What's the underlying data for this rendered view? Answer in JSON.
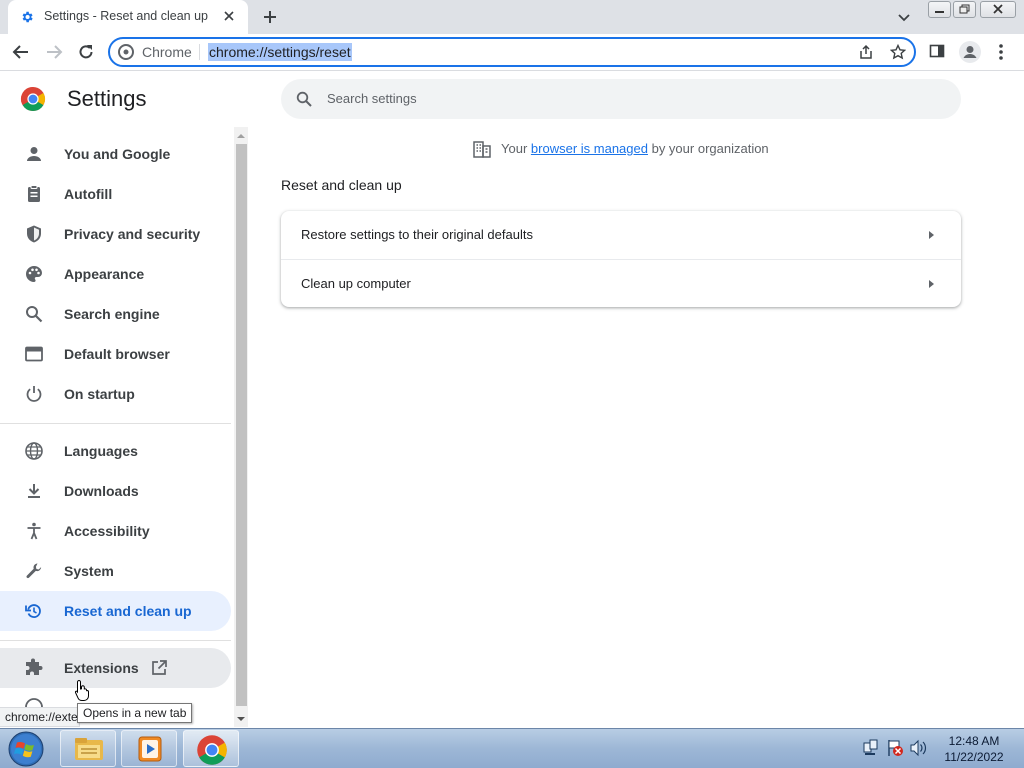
{
  "browser": {
    "tab_title": "Settings - Reset and clean up",
    "omnibox_chip": "Chrome",
    "url": "chrome://settings/reset"
  },
  "settings": {
    "brand_title": "Settings",
    "search_placeholder": "Search settings",
    "nav": [
      {
        "label": "You and Google",
        "icon": "person-icon"
      },
      {
        "label": "Autofill",
        "icon": "clipboard-icon"
      },
      {
        "label": "Privacy and security",
        "icon": "shield-icon"
      },
      {
        "label": "Appearance",
        "icon": "palette-icon"
      },
      {
        "label": "Search engine",
        "icon": "search-icon"
      },
      {
        "label": "Default browser",
        "icon": "browser-window-icon"
      },
      {
        "label": "On startup",
        "icon": "power-icon"
      },
      {
        "label": "Languages",
        "icon": "globe-icon"
      },
      {
        "label": "Downloads",
        "icon": "download-icon"
      },
      {
        "label": "Accessibility",
        "icon": "accessibility-icon"
      },
      {
        "label": "System",
        "icon": "wrench-icon"
      },
      {
        "label": "Reset and clean up",
        "icon": "reset-icon",
        "active": true
      },
      {
        "label": "Extensions",
        "icon": "puzzle-icon"
      }
    ],
    "managed_prefix": "Your",
    "managed_link": "browser is managed",
    "managed_suffix": "by your organization",
    "section_title": "Reset and clean up",
    "rows": [
      {
        "label": "Restore settings to their original defaults"
      },
      {
        "label": "Clean up computer"
      }
    ]
  },
  "status_url": "chrome://exte",
  "tooltip": "Opens in a new tab",
  "taskbar": {
    "time": "12:48 AM",
    "date": "11/22/2022"
  },
  "colors": {
    "accent": "#1a73e8",
    "active_nav_bg": "#e8f0fe",
    "active_nav_text": "#1967d2"
  }
}
